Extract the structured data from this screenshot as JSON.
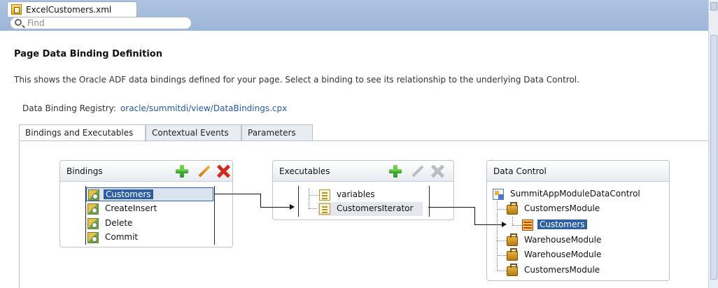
{
  "tab": {
    "title": "ExcelCustomers.xml",
    "close": "×"
  },
  "find": {
    "placeholder": "Find"
  },
  "page": {
    "title": "Page Data Binding Definition",
    "description": "This shows the Oracle ADF data bindings defined for your page. Select a binding to see its relationship to the underlying Data Control.",
    "registry_label": "Data Binding Registry:",
    "registry_link": "oracle/summitdi/view/DataBindings.cpx"
  },
  "inner_tabs": [
    "Bindings and Executables",
    "Contextual Events",
    "Parameters"
  ],
  "bindings": {
    "title": "Bindings",
    "items": [
      "Customers",
      "CreateInsert",
      "Delete",
      "Commit"
    ]
  },
  "executables": {
    "title": "Executables",
    "items": [
      "variables",
      "CustomersIterator"
    ]
  },
  "data_control": {
    "title": "Data Control",
    "root": "SummitAppModuleDataControl",
    "items": [
      "CustomersModule",
      "Customers",
      "WarehouseModule",
      "WarehouseModule",
      "CustomersModule"
    ]
  },
  "icons": {
    "add": "plus-icon",
    "edit": "pencil-icon",
    "delete": "delete-icon",
    "binding": "binding-icon",
    "module": "bag-icon",
    "collection": "table-icon"
  },
  "colors": {
    "selection": "#2e5fa3",
    "link": "#2659a8",
    "add": "#2fa52f",
    "delete": "#d32a1e"
  }
}
